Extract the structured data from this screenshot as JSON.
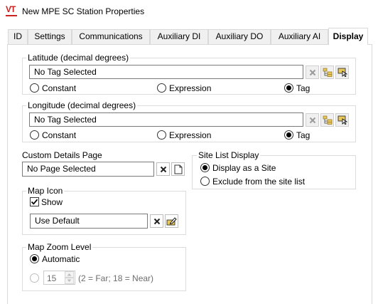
{
  "window": {
    "logo_text": "VT",
    "title": "New MPE SC Station Properties"
  },
  "tabs": [
    {
      "label": "ID"
    },
    {
      "label": "Settings"
    },
    {
      "label": "Communications"
    },
    {
      "label": "Auxiliary DI"
    },
    {
      "label": "Auxiliary DO"
    },
    {
      "label": "Auxiliary AI"
    },
    {
      "label": "Display",
      "active": true
    }
  ],
  "latitude": {
    "legend": "Latitude (decimal degrees)",
    "value": "No Tag Selected",
    "options": [
      "Constant",
      "Expression",
      "Tag"
    ],
    "selected": "Tag"
  },
  "longitude": {
    "legend": "Longitude (decimal degrees)",
    "value": "No Tag Selected",
    "options": [
      "Constant",
      "Expression",
      "Tag"
    ],
    "selected": "Tag"
  },
  "custom_details": {
    "label": "Custom Details Page",
    "value": "No Page Selected"
  },
  "site_list_display": {
    "legend": "Site List Display",
    "options": [
      "Display as a Site",
      "Exclude from the site list"
    ],
    "selected": "Display as a Site"
  },
  "map_icon": {
    "legend": "Map Icon",
    "show_label": "Show",
    "show_checked": true,
    "value": "Use Default"
  },
  "map_zoom": {
    "legend": "Map Zoom Level",
    "automatic_label": "Automatic",
    "selected": "Automatic",
    "level_value": "15",
    "hint": "(2 = Far;  18 = Near)"
  },
  "colors": {
    "accent_red": "#cc2222",
    "tag_folder_yellow": "#e8c85a"
  }
}
